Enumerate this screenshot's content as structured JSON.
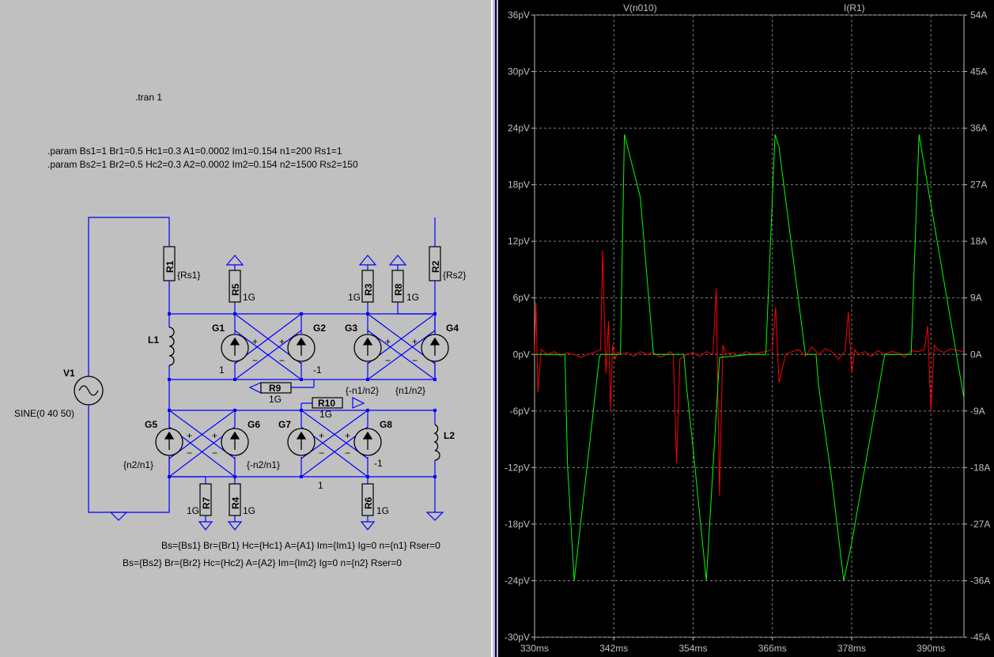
{
  "schematic": {
    "tran_directive": ".tran 1",
    "param_line_1": ".param Bs1=1 Br1=0.5 Hc1=0.3 A1=0.0002 Im1=0.154 n1=200 Rs1=1",
    "param_line_2": ".param Bs2=1 Br2=0.5 Hc2=0.3 A2=0.0002 Im2=0.154 n2=1500 Rs2=150",
    "model_line_1": "Bs={Bs1} Br={Br1} Hc={Hc1} A={A1} Im={Im1} Ig=0 n={n1} Rser=0",
    "model_line_2": "Bs={Bs2} Br={Br2} Hc={Hc2} A={A2} Im={Im2} Ig=0 n={n2} Rser=0",
    "source": {
      "name": "V1",
      "value": "SINE(0 40 50)"
    },
    "inductors": {
      "l1": "L1",
      "l2": "L2"
    },
    "resistors": {
      "r1": {
        "name": "R1",
        "value": "{Rs1}"
      },
      "r2": {
        "name": "R2",
        "value": "{Rs2}"
      },
      "r3": {
        "name": "R3",
        "value": "1G"
      },
      "r4": {
        "name": "R4",
        "value": "1G"
      },
      "r5": {
        "name": "R5",
        "value": "1G"
      },
      "r6": {
        "name": "R6",
        "value": "1G"
      },
      "r7": {
        "name": "R7",
        "value": "1G"
      },
      "r8": {
        "name": "R8",
        "value": "1G"
      },
      "r9": {
        "name": "R9",
        "value": "1G"
      },
      "r10": {
        "name": "R10",
        "value": "1G"
      }
    },
    "sources": {
      "g1": {
        "name": "G1",
        "value": "1"
      },
      "g2": {
        "name": "G2",
        "value": "-1"
      },
      "g3": {
        "name": "G3",
        "value": "{-n1/n2}"
      },
      "g4": {
        "name": "G4",
        "value": "{n1/n2}"
      },
      "g5": {
        "name": "G5",
        "value": "{n2/n1}"
      },
      "g6": {
        "name": "G6",
        "value": "{-n2/n1}"
      },
      "g7": {
        "name": "G7",
        "value": "1"
      },
      "g8": {
        "name": "G8",
        "value": "-1"
      }
    },
    "plus_sign": "+",
    "minus_sign": "−"
  },
  "colors": {
    "wire": "#0000ff",
    "trace_voltage": "#ff0000",
    "trace_current": "#00ff00",
    "grid": "#808080",
    "axis_text": "#c0c0c0"
  },
  "chart_data": {
    "type": "line",
    "grid": true,
    "legend": "top",
    "x": {
      "range": [
        330,
        395
      ],
      "unit": "ms",
      "ticks": [
        "330ms",
        "342ms",
        "354ms",
        "366ms",
        "378ms",
        "390ms"
      ],
      "tick_values": [
        330,
        342,
        354,
        366,
        378,
        390
      ]
    },
    "y_left": {
      "range": [
        -30,
        36
      ],
      "unit": "pV",
      "ticks": [
        "36pV",
        "30pV",
        "24pV",
        "18pV",
        "12pV",
        "6pV",
        "0pV",
        "-6pV",
        "-12pV",
        "-18pV",
        "-24pV",
        "-30pV"
      ],
      "tick_values": [
        36,
        30,
        24,
        18,
        12,
        6,
        0,
        -6,
        -12,
        -18,
        -24,
        -30
      ]
    },
    "y_right": {
      "range": [
        -45,
        54
      ],
      "unit": "A",
      "ticks": [
        "54A",
        "45A",
        "36A",
        "27A",
        "18A",
        "9A",
        "0A",
        "-9A",
        "-18A",
        "-27A",
        "-36A",
        "-45A"
      ],
      "tick_values": [
        54,
        45,
        36,
        27,
        18,
        9,
        0,
        -9,
        -18,
        -27,
        -36,
        -45
      ]
    },
    "series": [
      {
        "name": "V(n010)",
        "axis": "left",
        "unit": "pV",
        "x": [
          330,
          330.2,
          330.5,
          331,
          332,
          333,
          334,
          335,
          336,
          337,
          338,
          339,
          340,
          340.3,
          340.8,
          341.2,
          341.5,
          341.8,
          342.2,
          342.6,
          343,
          344,
          345,
          346,
          347,
          348,
          349,
          350,
          350.5,
          351,
          351.5,
          352,
          353,
          354,
          355,
          356,
          357,
          357.5,
          358,
          358.5,
          359,
          360,
          361,
          362,
          363,
          364,
          365,
          366,
          366.5,
          367,
          368,
          369,
          370,
          371,
          372,
          373,
          374,
          375,
          376,
          377,
          377.5,
          378,
          378.5,
          379,
          380,
          381,
          382,
          383,
          384,
          385,
          386,
          387,
          388,
          389,
          389.5,
          390,
          390.5,
          391,
          392,
          393,
          394,
          395
        ],
        "y": [
          0,
          5.5,
          -4,
          0.5,
          0,
          0.3,
          -0.2,
          0.2,
          0,
          -0.3,
          0,
          0.2,
          0.5,
          11,
          -2,
          3.5,
          -6,
          1,
          -0.5,
          0.3,
          0,
          0.2,
          -0.2,
          0.3,
          0,
          0.2,
          -0.3,
          0,
          0.3,
          0,
          -11.5,
          -0.5,
          0,
          0.2,
          -0.2,
          0.3,
          0,
          7,
          -15,
          1,
          0,
          0.2,
          -0.2,
          0.3,
          0,
          0.2,
          0.3,
          0.5,
          5,
          -3,
          0,
          0.3,
          0.5,
          -0.2,
          0.8,
          0,
          0.6,
          0.3,
          -0.5,
          0.4,
          4.5,
          -2,
          0.5,
          0,
          0.3,
          -0.2,
          0.4,
          0,
          0.3,
          0.2,
          -0.3,
          0.4,
          0.3,
          0.5,
          3,
          -6,
          1,
          0.5,
          0.2,
          0.6,
          0.4,
          0.3
        ]
      },
      {
        "name": "I(R1)",
        "axis": "right",
        "unit": "A",
        "x": [
          330,
          334.6,
          335,
          336,
          339.8,
          340,
          343,
          343.6,
          346,
          348,
          352.6,
          353,
          354,
          356,
          358,
          362.6,
          363,
          365,
          366.4,
          367,
          371,
          372.6,
          373,
          375,
          376.8,
          378,
          383,
          384.6,
          385,
          387,
          388.2,
          389,
          395
        ],
        "y": [
          0,
          0,
          -18,
          -36,
          -0.5,
          0,
          0,
          35,
          25,
          0,
          0,
          -5,
          -15,
          -36,
          -0.5,
          0,
          0,
          0,
          35,
          33,
          0,
          0,
          -5,
          -20,
          -36,
          -30,
          0,
          0,
          0,
          0,
          35,
          30,
          -7
        ]
      }
    ]
  }
}
